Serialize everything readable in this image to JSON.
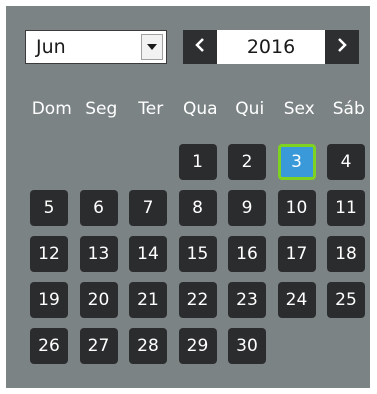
{
  "month_select": {
    "value": "Jun",
    "arrow_icon": "chevron-down-icon"
  },
  "year_nav": {
    "year": "2016",
    "prev_label": "<",
    "next_label": ">"
  },
  "weekdays": [
    "Dom",
    "Seg",
    "Ter",
    "Qua",
    "Qui",
    "Sex",
    "Sáb"
  ],
  "days": [
    {
      "label": "1",
      "col": 3,
      "row": 0
    },
    {
      "label": "2",
      "col": 4,
      "row": 0
    },
    {
      "label": "3",
      "col": 5,
      "row": 0,
      "selected": true
    },
    {
      "label": "4",
      "col": 6,
      "row": 0
    },
    {
      "label": "5",
      "col": 0,
      "row": 1
    },
    {
      "label": "6",
      "col": 1,
      "row": 1
    },
    {
      "label": "7",
      "col": 2,
      "row": 1
    },
    {
      "label": "8",
      "col": 3,
      "row": 1
    },
    {
      "label": "9",
      "col": 4,
      "row": 1
    },
    {
      "label": "10",
      "col": 5,
      "row": 1
    },
    {
      "label": "11",
      "col": 6,
      "row": 1
    },
    {
      "label": "12",
      "col": 0,
      "row": 2
    },
    {
      "label": "13",
      "col": 1,
      "row": 2
    },
    {
      "label": "14",
      "col": 2,
      "row": 2
    },
    {
      "label": "15",
      "col": 3,
      "row": 2
    },
    {
      "label": "16",
      "col": 4,
      "row": 2
    },
    {
      "label": "17",
      "col": 5,
      "row": 2
    },
    {
      "label": "18",
      "col": 6,
      "row": 2
    },
    {
      "label": "19",
      "col": 0,
      "row": 3
    },
    {
      "label": "20",
      "col": 1,
      "row": 3
    },
    {
      "label": "21",
      "col": 2,
      "row": 3
    },
    {
      "label": "22",
      "col": 3,
      "row": 3
    },
    {
      "label": "23",
      "col": 4,
      "row": 3
    },
    {
      "label": "24",
      "col": 5,
      "row": 3
    },
    {
      "label": "25",
      "col": 6,
      "row": 3
    },
    {
      "label": "26",
      "col": 0,
      "row": 4
    },
    {
      "label": "27",
      "col": 1,
      "row": 4
    },
    {
      "label": "28",
      "col": 2,
      "row": 4
    },
    {
      "label": "29",
      "col": 3,
      "row": 4
    },
    {
      "label": "30",
      "col": 4,
      "row": 4
    }
  ],
  "colors": {
    "panel_bg": "#7b8385",
    "day_bg": "#2b2c2d",
    "selected_bg": "#3a99d8",
    "selected_border": "#7ed321"
  }
}
